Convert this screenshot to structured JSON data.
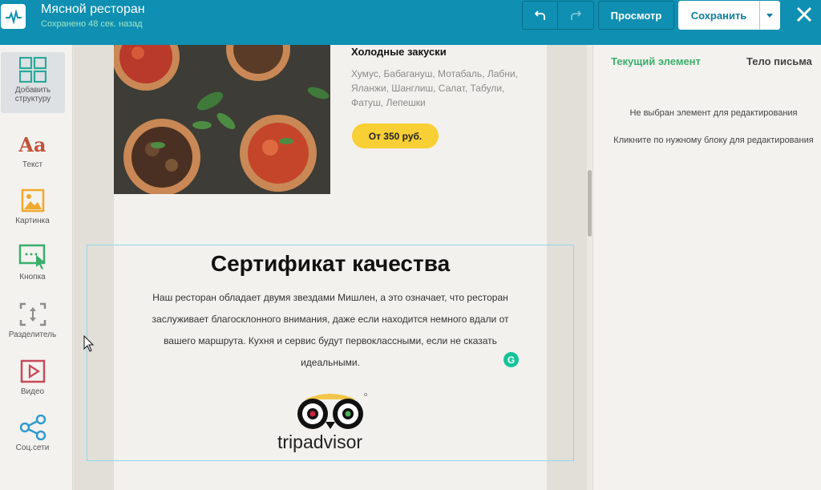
{
  "header": {
    "title": "Мясной ресторан",
    "save_status": "Сохранено 48 сек. назад",
    "preview_label": "Просмотр",
    "save_label": "Сохранить"
  },
  "sidebar": {
    "items": [
      {
        "label": "Добавить структуру",
        "icon": "structure-grid-icon"
      },
      {
        "label": "Текст",
        "icon": "text-icon",
        "glyph": "Aa"
      },
      {
        "label": "Картинка",
        "icon": "image-icon"
      },
      {
        "label": "Кнопка",
        "icon": "button-icon"
      },
      {
        "label": "Разделитель",
        "icon": "divider-icon"
      },
      {
        "label": "Видео",
        "icon": "video-icon"
      },
      {
        "label": "Соц.сети",
        "icon": "share-icon"
      }
    ]
  },
  "email": {
    "menu_item": {
      "title": "Холодные закуски",
      "description": "Хумус, Бабагануш, Мотабаль, Лабни, Яланжи, Шанглиш, Салат, Табули, Фатуш, Лепешки",
      "price_button": "От 350 руб."
    },
    "certificate": {
      "title": "Сертификат качества",
      "text": "Наш ресторан обладает двумя звездами Мишлен, а это означает, что ресторан заслуживает благосклонного внимания, даже если находится немного вдали от вашего маршрута. Кухня и сервис будут первоклассными, если не сказать идеальными.",
      "logo_text": "tripadvisor"
    }
  },
  "right_panel": {
    "tabs": [
      "Текущий элемент",
      "Тело письма"
    ],
    "message_1": "Не выбран элемент для редактирования",
    "message_2": "Кликните по нужному блоку для редактирования"
  },
  "colors": {
    "topbar": "#0f8fb1",
    "accent_green": "#3aae6a",
    "price_button": "#f8cf35"
  }
}
